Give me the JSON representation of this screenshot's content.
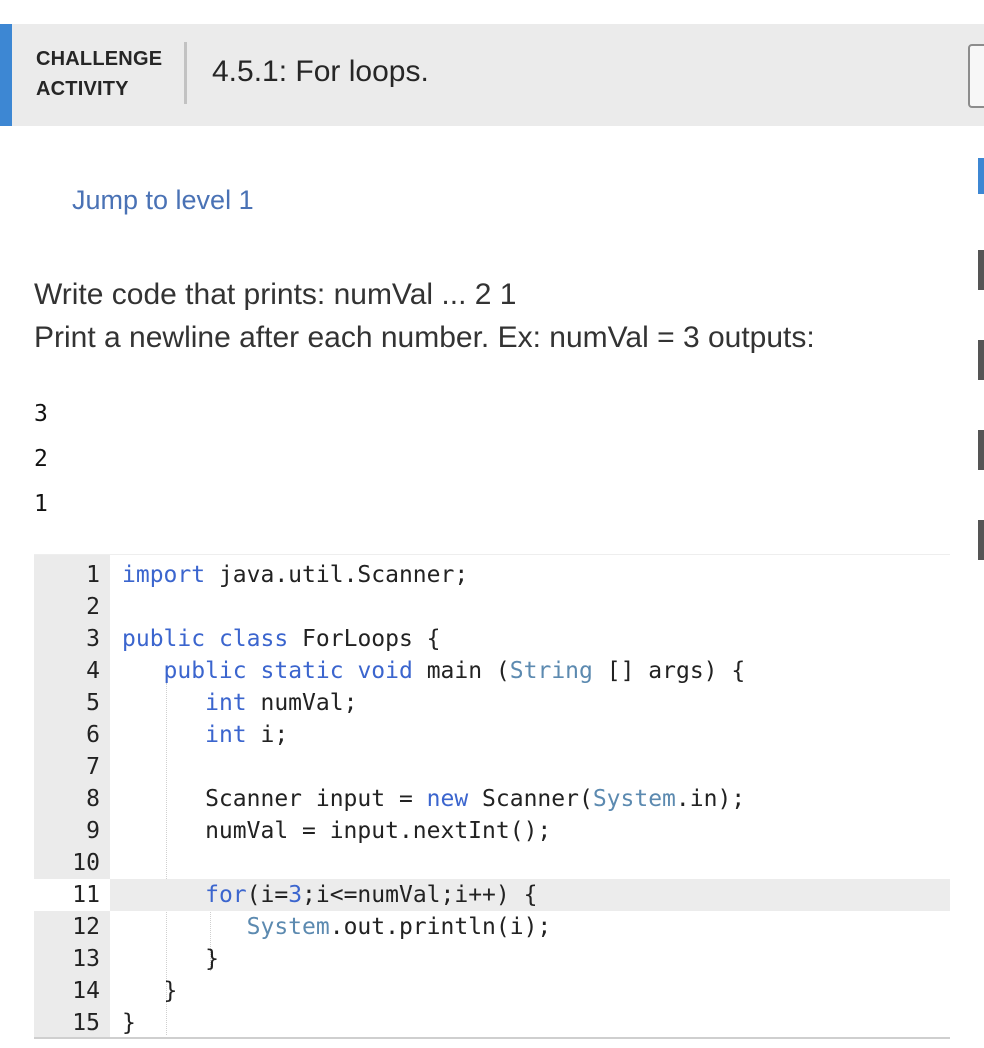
{
  "header": {
    "label_line1": "CHALLENGE",
    "label_line2": "ACTIVITY",
    "title": "4.5.1: For loops."
  },
  "level_link": "Jump to level 1",
  "instructions": {
    "line1": "Write code that prints: numVal ... 2 1",
    "line2": "Print a newline after each number. Ex: numVal = 3 outputs:"
  },
  "example_output": [
    "3",
    "2",
    "1"
  ],
  "editor": {
    "active_line": 11,
    "lines": [
      {
        "n": "1",
        "tokens": [
          [
            "kw",
            "import"
          ],
          [
            "",
            "java.util.Scanner;"
          ]
        ]
      },
      {
        "n": "2",
        "tokens": []
      },
      {
        "n": "3",
        "tokens": [
          [
            "kw",
            "public"
          ],
          [
            "",
            ""
          ],
          [
            "kw",
            "class"
          ],
          [
            "",
            "ForLoops {"
          ]
        ]
      },
      {
        "n": "4",
        "tokens": [
          [
            "",
            "   "
          ],
          [
            "kw",
            "public"
          ],
          [
            "",
            ""
          ],
          [
            "kw",
            "static"
          ],
          [
            "",
            ""
          ],
          [
            "kw",
            "void"
          ],
          [
            "",
            "main ("
          ],
          [
            "str",
            "String"
          ],
          [
            "",
            ""
          ],
          [
            "",
            "[] args) {"
          ]
        ]
      },
      {
        "n": "5",
        "tokens": [
          [
            "",
            "      "
          ],
          [
            "kw",
            "int"
          ],
          [
            "",
            "numVal;"
          ]
        ]
      },
      {
        "n": "6",
        "tokens": [
          [
            "",
            "      "
          ],
          [
            "kw",
            "int"
          ],
          [
            "",
            "i;"
          ]
        ]
      },
      {
        "n": "7",
        "tokens": []
      },
      {
        "n": "8",
        "tokens": [
          [
            "",
            "      Scanner input = "
          ],
          [
            "kw",
            "new"
          ],
          [
            "",
            "Scanner("
          ],
          [
            "str",
            "System"
          ],
          [
            "",
            ".in);"
          ]
        ]
      },
      {
        "n": "9",
        "tokens": [
          [
            "",
            "      numVal = input.nextInt();"
          ]
        ]
      },
      {
        "n": "10",
        "tokens": []
      },
      {
        "n": "11",
        "tokens": [
          [
            "",
            "      "
          ],
          [
            "kw",
            "for"
          ],
          [
            "",
            "(i="
          ],
          [
            "num",
            "3"
          ],
          [
            "",
            ";i<=numVal;i++) {"
          ]
        ]
      },
      {
        "n": "12",
        "tokens": [
          [
            "",
            "         "
          ],
          [
            "str",
            "System"
          ],
          [
            "",
            ".out.println(i);"
          ]
        ]
      },
      {
        "n": "13",
        "tokens": [
          [
            "",
            "      }"
          ]
        ]
      },
      {
        "n": "14",
        "tokens": [
          [
            "",
            "   }"
          ]
        ]
      },
      {
        "n": "15",
        "tokens": [
          [
            "",
            "}"
          ]
        ]
      }
    ]
  },
  "colors": {
    "accent": "#3d87d3",
    "header_bg": "#ebebeb",
    "keyword": "#3b65ce",
    "link": "#4a72b5"
  }
}
